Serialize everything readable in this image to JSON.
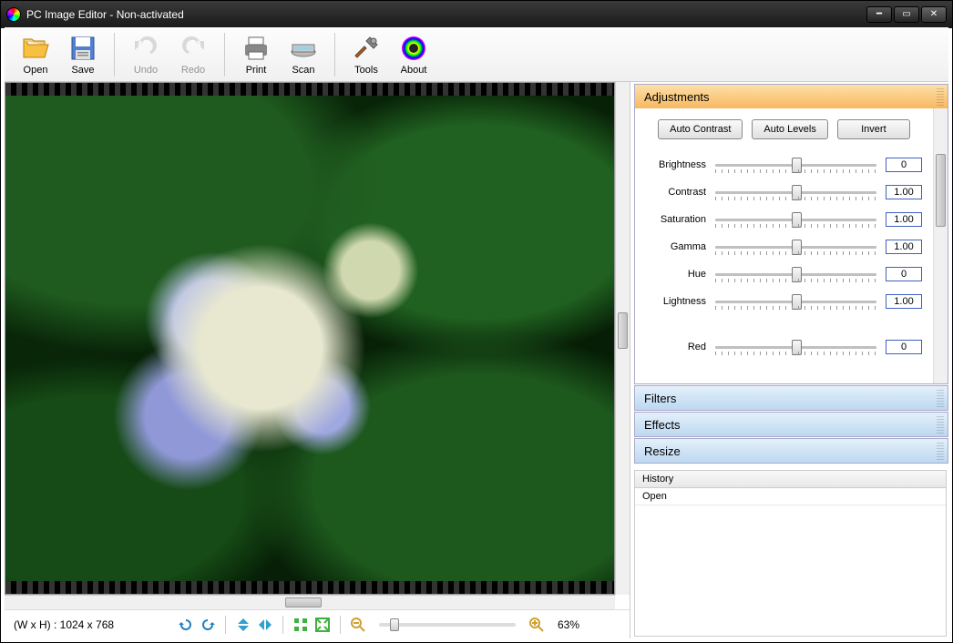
{
  "title": "PC Image Editor - Non-activated",
  "toolbar": {
    "open": "Open",
    "save": "Save",
    "undo": "Undo",
    "redo": "Redo",
    "print": "Print",
    "scan": "Scan",
    "tools": "Tools",
    "about": "About"
  },
  "status": {
    "dimensions": "(W x H) : 1024 x 768",
    "zoom": "63%"
  },
  "adjustments": {
    "header": "Adjustments",
    "auto_contrast": "Auto Contrast",
    "auto_levels": "Auto Levels",
    "invert": "Invert",
    "sliders": [
      {
        "label": "Brightness",
        "value": "0"
      },
      {
        "label": "Contrast",
        "value": "1.00"
      },
      {
        "label": "Saturation",
        "value": "1.00"
      },
      {
        "label": "Gamma",
        "value": "1.00"
      },
      {
        "label": "Hue",
        "value": "0"
      },
      {
        "label": "Lightness",
        "value": "1.00"
      }
    ],
    "red": {
      "label": "Red",
      "value": "0"
    }
  },
  "panels": {
    "filters": "Filters",
    "effects": "Effects",
    "resize": "Resize"
  },
  "history": {
    "header": "History",
    "items": [
      "Open"
    ]
  }
}
